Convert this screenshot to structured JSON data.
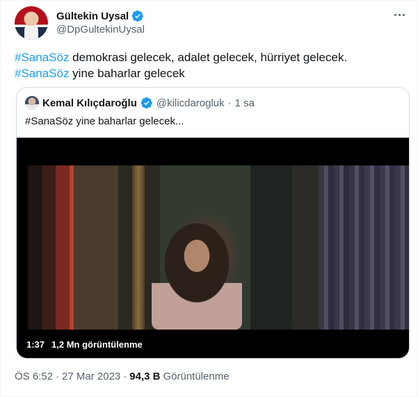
{
  "tweet": {
    "author_name": "Gültekin Uysal",
    "author_handle": "@DpGultekinUysal",
    "line1_hashtag": "#SanaSöz",
    "line1_text": " demokrasi gelecek, adalet gelecek, hürriyet gelecek.",
    "line2_hashtag": "#SanaSöz",
    "line2_text": " yine baharlar gelecek"
  },
  "quote": {
    "author_name": "Kemal Kılıçdaroğlu",
    "author_handle": "@kilicdarogluk",
    "separator": "·",
    "time": "1 sa",
    "text": "#SanaSöz yine baharlar gelecek...",
    "video": {
      "duration": "1:37",
      "views": "1,2 Mn görüntülenme"
    }
  },
  "meta": {
    "time": "ÖS 6:52",
    "sep1": "·",
    "date": "27 Mar 2023",
    "sep2": "·",
    "views_count": "94,3 B",
    "views_label": "Görüntülenme"
  },
  "colors": {
    "accent": "#1d9bf0",
    "verified": "#1d9bf0",
    "text_primary": "#0f1419",
    "text_secondary": "#536471",
    "border": "#cfd9de"
  },
  "icons": {
    "verified": "verified-badge-icon",
    "more": "more-dots-icon"
  }
}
